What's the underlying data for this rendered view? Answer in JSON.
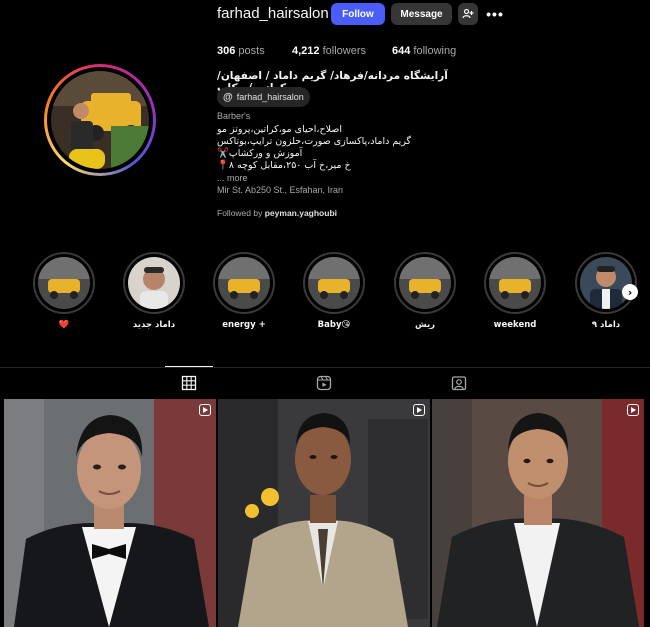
{
  "profile": {
    "username": "farhad_hairsalon",
    "follow_label": "Follow",
    "message_label": "Message",
    "posts_count": "306",
    "posts_label": "posts",
    "followers_count": "4,212",
    "followers_label": "followers",
    "following_count": "644",
    "following_label": "following",
    "full_name": "آرایشگاه مردانه/فرهاد/ گریم داماد / اصفهان/کراتین/میکاپ",
    "threads_handle": "farhad_hairsalon",
    "category": "Barber's",
    "bio_lines": [
      "اصلاح،احیای مو،کراتین،پروتز مو",
      "گریم داماد،پاکسازی صورت،حلزون ترایپ،بوتاکس",
      "✂️آموزش و ورکشاپ",
      "📍خ میر،خ آب ۲۵۰،مقابل کوچه ۸"
    ],
    "more_label": "... more",
    "address": "Mir St. Ab250 St., Esfahan, Iran",
    "followed_by_prefix": "Followed by",
    "followed_by_user": "peyman.yaghoubi"
  },
  "highlights": [
    {
      "label": "❤️"
    },
    {
      "label": "داماد جدید"
    },
    {
      "label": "energy +"
    },
    {
      "label": "Baby😘"
    },
    {
      "label": "ریش"
    },
    {
      "label": "weekend"
    },
    {
      "label": "داماد ۹"
    }
  ],
  "icons": {
    "add_user": "add-person-icon",
    "more": "more-dots-icon",
    "threads": "threads-icon",
    "grid_tab": "grid-icon",
    "reels_tab": "reels-icon",
    "tagged_tab": "tagged-icon",
    "next": "chevron-right-icon",
    "reel": "reel-icon"
  },
  "colors": {
    "follow_button": "#4a5df9",
    "secondary_button": "#363636",
    "background": "#000000"
  }
}
